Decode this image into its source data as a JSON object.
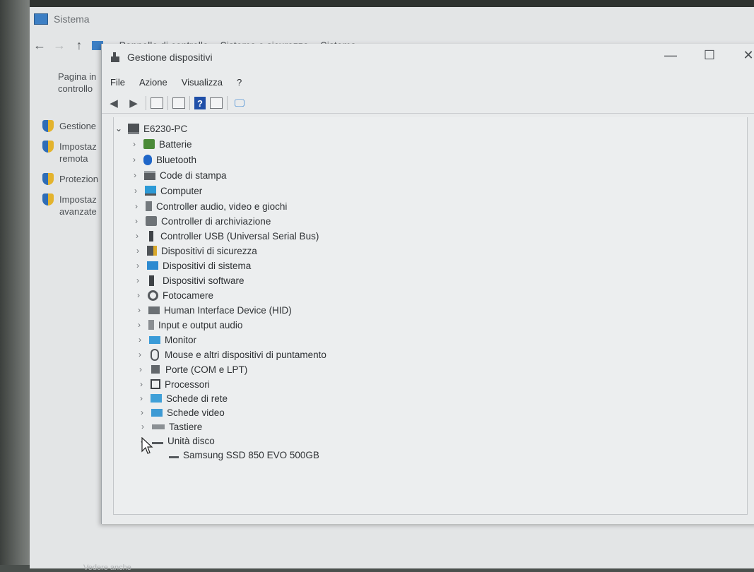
{
  "background_window": {
    "title": "Sistema",
    "nav": {
      "back": "←",
      "forward": "→",
      "up": "↑"
    },
    "breadcrumb": [
      "Pannello di controllo",
      "Sistema e sicurezza",
      "Sistema"
    ],
    "side_home": "Pagina iniziale Pannello di controllo",
    "side_home_lines": [
      "Pagina in",
      "controllo"
    ],
    "side_links": [
      {
        "lines": [
          "Gestione"
        ]
      },
      {
        "lines": [
          "Impostaz",
          "remota"
        ]
      },
      {
        "lines": [
          "Protezion"
        ]
      },
      {
        "lines": [
          "Impostaz",
          "avanzate"
        ]
      }
    ],
    "footer": "Vedere anche"
  },
  "device_manager": {
    "title": "Gestione dispositivi",
    "window_controls": {
      "minimize": "—",
      "maximize": "☐",
      "close": "✕"
    },
    "menu": [
      "File",
      "Azione",
      "Visualizza",
      "?"
    ],
    "toolbar": [
      "back-arrow-icon",
      "forward-arrow-icon",
      "properties-grid-icon",
      "list-view-icon",
      "help-icon",
      "update-driver-icon",
      "monitor-icon"
    ],
    "tree": {
      "root": "E6230-PC",
      "categories": [
        {
          "label": "Batterie",
          "icon": "battery-icon"
        },
        {
          "label": "Bluetooth",
          "icon": "bluetooth-icon"
        },
        {
          "label": "Code di stampa",
          "icon": "printer-icon"
        },
        {
          "label": "Computer",
          "icon": "computer-icon"
        },
        {
          "label": "Controller audio, video e giochi",
          "icon": "speaker-icon"
        },
        {
          "label": "Controller di archiviazione",
          "icon": "storage-icon"
        },
        {
          "label": "Controller USB (Universal Serial Bus)",
          "icon": "usb-icon"
        },
        {
          "label": "Dispositivi di sicurezza",
          "icon": "security-device-icon"
        },
        {
          "label": "Dispositivi di sistema",
          "icon": "system-device-icon"
        },
        {
          "label": "Dispositivi software",
          "icon": "software-device-icon"
        },
        {
          "label": "Fotocamere",
          "icon": "camera-icon"
        },
        {
          "label": "Human Interface Device (HID)",
          "icon": "hid-icon"
        },
        {
          "label": "Input e output audio",
          "icon": "audio-io-icon"
        },
        {
          "label": "Monitor",
          "icon": "monitor-icon"
        },
        {
          "label": "Mouse e altri dispositivi di puntamento",
          "icon": "mouse-icon"
        },
        {
          "label": "Porte (COM e LPT)",
          "icon": "port-icon"
        },
        {
          "label": "Processori",
          "icon": "processor-icon"
        },
        {
          "label": "Schede di rete",
          "icon": "network-adapter-icon"
        },
        {
          "label": "Schede video",
          "icon": "display-adapter-icon"
        },
        {
          "label": "Tastiere",
          "icon": "keyboard-icon"
        },
        {
          "label": "Unità disco",
          "icon": "disk-drive-icon",
          "expanded": true
        }
      ],
      "disk_child": "Samsung SSD 850 EVO 500GB"
    }
  }
}
